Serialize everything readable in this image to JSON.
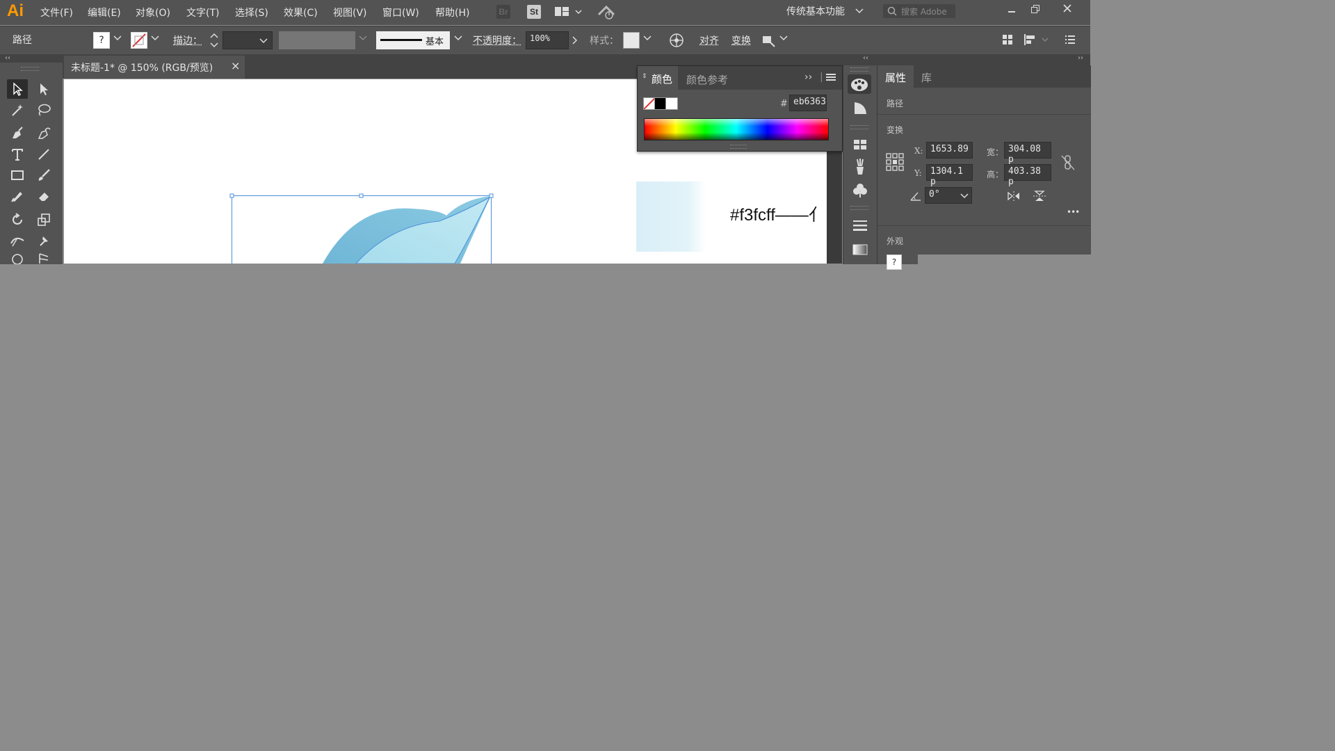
{
  "app": {
    "logo": "Ai",
    "menus": [
      "文件(F)",
      "编辑(E)",
      "对象(O)",
      "文字(T)",
      "选择(S)",
      "效果(C)",
      "视图(V)",
      "窗口(W)",
      "帮助(H)"
    ],
    "bridge_label": "Br",
    "stock_label": "St",
    "workspace": "传统基本功能",
    "search_placeholder": "搜索 Adobe"
  },
  "control_bar": {
    "selection_type": "路径",
    "fill_unknown": "?",
    "stroke_label": "描边：",
    "stroke_profile": "基本",
    "opacity_label": "不透明度：",
    "opacity_value": "100%",
    "style_label": "样式：",
    "align_label": "对齐",
    "transform_label": "变换"
  },
  "document": {
    "tab_title": "未标题-1* @ 150% (RGB/预览)",
    "close_glyph": "×",
    "canvas_note": "#f3fcff——",
    "canvas_note_cut": "亻"
  },
  "color_panel": {
    "tabs": [
      "颜色",
      "颜色参考"
    ],
    "hash": "#",
    "hex_value": "eb6363"
  },
  "properties_panel": {
    "tabs": [
      "属性",
      "库"
    ],
    "section_path": "路径",
    "section_transform": "变换",
    "x_label": "X:",
    "x_value": "1653.89",
    "y_label": "Y:",
    "y_value": "1304.1 p",
    "w_label": "宽：",
    "w_value": "304.08 p",
    "h_label": "高：",
    "h_value": "403.38 p",
    "angle_value": "0°",
    "section_appearance": "外观",
    "appearance_unknown": "?",
    "more": "•••"
  },
  "colors": {
    "accent_logo": "#ff9a00",
    "selection_blue": "#4a8fd8",
    "hex_color": "#eb6363",
    "swatch_light": "#f3fcff"
  }
}
